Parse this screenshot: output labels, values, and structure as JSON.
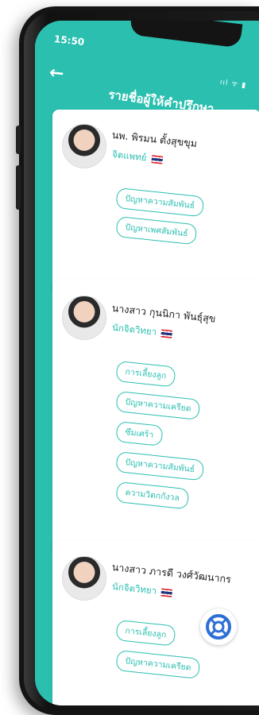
{
  "status_bar": {
    "time": "15:50",
    "icons": "ııl ᯤ ▮"
  },
  "header": {
    "title": "รายชื่อผู้ให้คำปรึกษา"
  },
  "colors": {
    "accent": "#2bbfb0",
    "card": "#ffffff",
    "flag": "thai-flag-icon"
  },
  "consultants": [
    {
      "name": "นพ. พิรมน ตั้งสุขขุม",
      "role": "จิตแพทย์",
      "tags": [
        "ปัญหาความสัมพันธ์",
        "ปัญหาเพศสัมพันธ์"
      ]
    },
    {
      "name": "นางสาว กุนนิกา พันธุ์สุข",
      "role": "นักจิตวิทยา",
      "tags": [
        "การเลี้ยงลูก",
        "ปัญหาความเครียด",
        "ซึมเศร้า",
        "ปัญหาความสัมพันธ์",
        "ความวิตกกังวล"
      ]
    },
    {
      "name": "นางสาว ภารดี วงศ์วัฒนากร",
      "role": "นักจิตวิทยา",
      "tags": [
        "การเลี้ยงลูก",
        "ปัญหาความเครียด"
      ]
    }
  ],
  "fab": {
    "icon": "lifebuoy-icon"
  }
}
